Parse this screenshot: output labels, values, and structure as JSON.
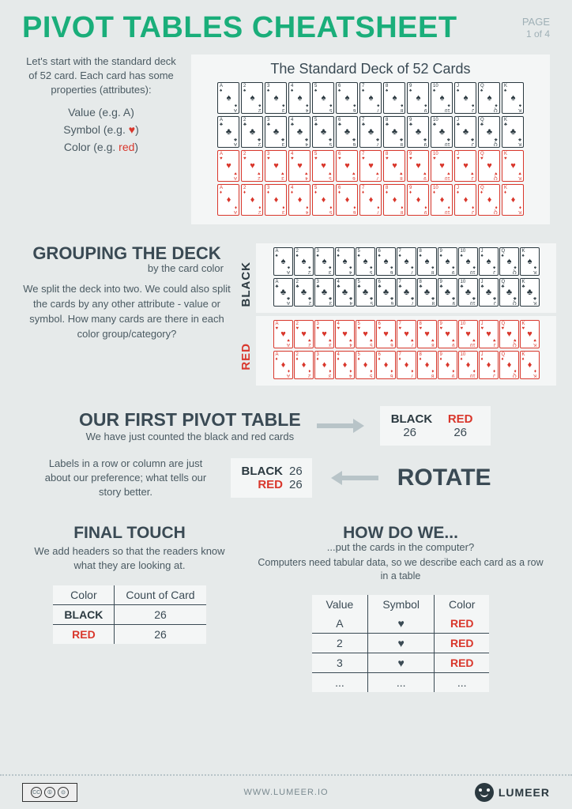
{
  "header": {
    "title": "PIVOT TABLES CHEATSHEET",
    "page_label": "PAGE",
    "page_num": "1 of 4"
  },
  "intro": {
    "text": "Let's start with the standard deck of 52 card. Each card has some properties (attributes):",
    "attr_value": "Value (e.g. A)",
    "attr_symbol_pre": "Symbol (e.g. ",
    "attr_symbol_glyph": "♥",
    "attr_symbol_post": ")",
    "attr_color_pre": "Color (e.g. ",
    "attr_color_red": "red",
    "attr_color_post": ")"
  },
  "deck": {
    "title": "The Standard Deck of 52 Cards",
    "ranks": [
      "A",
      "2",
      "3",
      "4",
      "5",
      "6",
      "7",
      "8",
      "9",
      "10",
      "J",
      "Q",
      "K"
    ],
    "suits": [
      {
        "glyph": "♠",
        "class": "blackc"
      },
      {
        "glyph": "♣",
        "class": "blackc"
      },
      {
        "glyph": "♥",
        "class": "redc"
      },
      {
        "glyph": "♦",
        "class": "redc"
      }
    ]
  },
  "grouping": {
    "heading": "GROUPING THE DECK",
    "sub": "by the card color",
    "para": "We split the deck into two. We could also split the cards by any other attribute - value or symbol. How many cards are there in each color group/category?",
    "label_black": "BLACK",
    "label_red": "RED"
  },
  "first_pivot": {
    "heading": "OUR FIRST PIVOT TABLE",
    "sub": "We have just counted the black and red cards",
    "black_label": "BLACK",
    "red_label": "RED",
    "black_count": "26",
    "red_count": "26"
  },
  "rotate": {
    "para": "Labels in a row or column are just about our preference; what tells our story better.",
    "black_label": "BLACK",
    "red_label": "RED",
    "black_count": "26",
    "red_count": "26",
    "word": "ROTATE"
  },
  "final_touch": {
    "heading": "FINAL TOUCH",
    "sub": "We add headers so that the readers know what they are looking at.",
    "col1": "Color",
    "col2": "Count of Card",
    "rows": [
      {
        "c": "BLACK",
        "n": "26",
        "cls": "blackc"
      },
      {
        "c": "RED",
        "n": "26",
        "cls": "redc"
      }
    ]
  },
  "howdo": {
    "heading": "HOW DO WE...",
    "sub1": "...put the cards in the computer?",
    "sub2": "Computers need tabular data, so we describe each card as a row in a table",
    "cols": [
      "Value",
      "Symbol",
      "Color"
    ],
    "rows": [
      {
        "v": "A",
        "s": "♥",
        "c": "RED"
      },
      {
        "v": "2",
        "s": "♥",
        "c": "RED"
      },
      {
        "v": "3",
        "s": "♥",
        "c": "RED"
      },
      {
        "v": "...",
        "s": "...",
        "c": "..."
      }
    ]
  },
  "footer": {
    "url": "WWW.LUMEER.IO",
    "brand": "LUMEER"
  }
}
